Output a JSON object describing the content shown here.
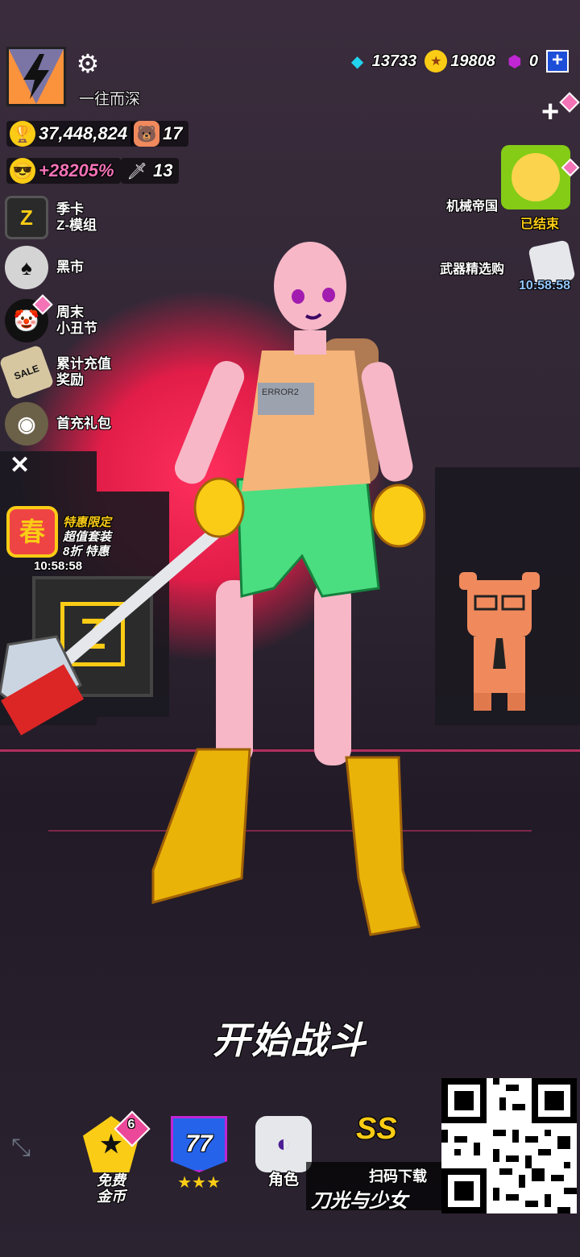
{
  "player": {
    "name": "一往而深",
    "trophies": "37,448,824",
    "pets": "17",
    "bonus": "+28205%",
    "weapons": "13"
  },
  "currency": {
    "gems": "13733",
    "coins": "19808",
    "cubes": "0"
  },
  "left_menu": [
    {
      "line1": "季卡",
      "line2": "Z-模组",
      "icon": "Z"
    },
    {
      "line1": "黑市",
      "line2": "",
      "icon": "A"
    },
    {
      "line1": "周末",
      "line2": "小丑节",
      "icon": "clown"
    },
    {
      "line1": "累计充值",
      "line2": "奖励",
      "icon": "SALE"
    },
    {
      "line1": "首充礼包",
      "line2": "",
      "icon": "bag"
    }
  ],
  "spring_offer": {
    "badge": "春",
    "line1": "特惠限定",
    "line2": "超值套装",
    "line3": "8折 特惠",
    "timer": "10:58:58"
  },
  "right_events": {
    "mech_empire_label": "机械帝国",
    "mech_empire_status": "已结束",
    "weapon_shop_label": "武器精选购",
    "weapon_shop_timer": "10:58:58"
  },
  "start_battle": "开始战斗",
  "bottom_bar": {
    "free_coins_label": "免费\n金币",
    "free_coins_badge": "6",
    "level": "77",
    "role_label": "角色",
    "rank": "SS"
  },
  "promo": {
    "scan_text": "扫码下载",
    "game_name": "刀光与少女"
  },
  "shirt_text": "ERROR2",
  "colors": {
    "accent_pink": "#e11d48",
    "gold": "#facc15",
    "bonus_pink": "#f472b6"
  }
}
